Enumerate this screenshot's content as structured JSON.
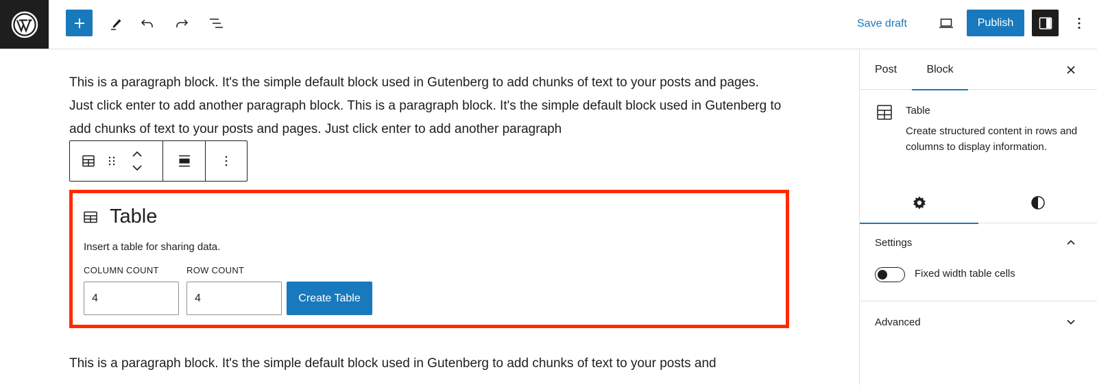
{
  "topbar": {
    "logo": "wordpress-logo",
    "inserter_icon": "plus-icon",
    "tools": [
      {
        "name": "edit-tool",
        "icon": "pencil-icon"
      },
      {
        "name": "undo",
        "icon": "undo-icon"
      },
      {
        "name": "redo",
        "icon": "redo-icon"
      },
      {
        "name": "document-overview",
        "icon": "list-view-icon"
      }
    ],
    "save_draft_label": "Save draft",
    "preview_icon": "desktop-preview-icon",
    "publish_label": "Publish",
    "settings_icon": "sidebar-toggle-icon",
    "options_icon": "more-vertical-icon"
  },
  "canvas": {
    "paragraph_1": "This is a paragraph block. It's the simple default block used in Gutenberg to add chunks of text to your posts and pages. Just click enter to add another paragraph block. This is a paragraph block. It's the simple default block used in Gutenberg to add chunks of text to your posts and pages. Just click enter to add another paragraph",
    "paragraph_2": "This is a paragraph block. It's the simple default block used in Gutenberg to add chunks of text to your posts and",
    "block_toolbar": {
      "block_type_icon": "table-icon",
      "drag_icon": "drag-handle-icon",
      "move_icons": [
        "chevron-up-icon",
        "chevron-down-icon"
      ],
      "align_icon": "align-wide-icon",
      "more_icon": "more-vertical-icon"
    },
    "table_placeholder": {
      "icon": "table-icon",
      "title": "Table",
      "description": "Insert a table for sharing data.",
      "column_count_label": "COLUMN COUNT",
      "column_count_value": "4",
      "row_count_label": "ROW COUNT",
      "row_count_value": "4",
      "create_button_label": "Create Table",
      "highlight_color": "#ff2a00"
    }
  },
  "sidebar": {
    "tabs": [
      {
        "label": "Post",
        "active": false
      },
      {
        "label": "Block",
        "active": true
      }
    ],
    "close_icon": "close-icon",
    "block_card": {
      "icon": "table-icon",
      "title": "Table",
      "description": "Create structured content in rows and columns to display information."
    },
    "subtabs": [
      {
        "icon": "gear-icon",
        "active": true
      },
      {
        "icon": "contrast-icon",
        "active": false
      }
    ],
    "panels": {
      "settings": {
        "title": "Settings",
        "expanded": true,
        "toggle_label": "Fixed width table cells",
        "toggle_on": false
      },
      "advanced": {
        "title": "Advanced",
        "expanded": false
      }
    }
  },
  "colors": {
    "accent": "#1979bd",
    "dark": "#1e1e1e",
    "border": "#e0e0e0"
  }
}
